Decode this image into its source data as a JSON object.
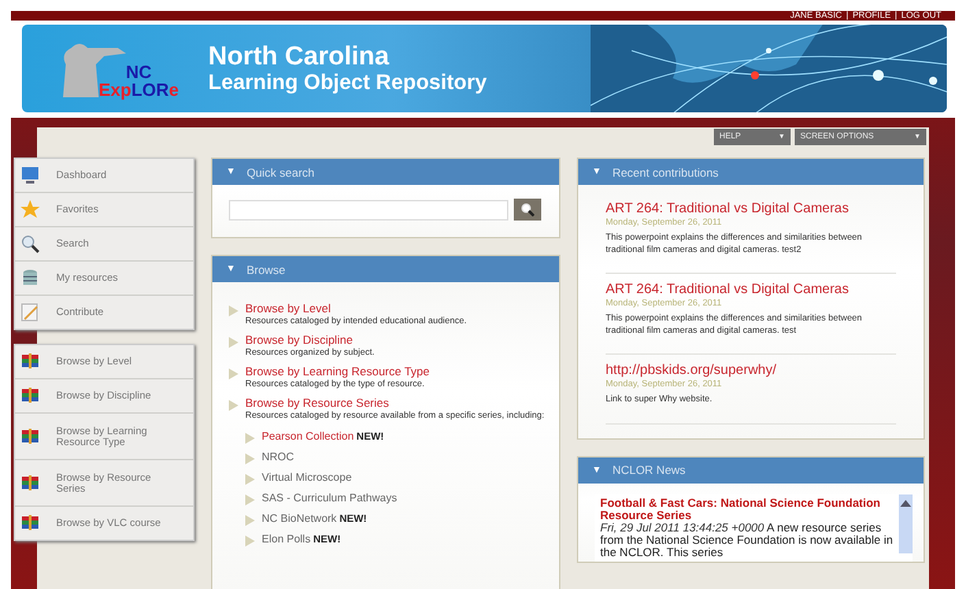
{
  "user_bar": {
    "links": [
      "JANE BASIC",
      "PROFILE",
      "LOG OUT"
    ],
    "separator": "|"
  },
  "banner": {
    "logo": {
      "line1": "NC",
      "line2": [
        {
          "text": "Exp",
          "color": "#e8202a"
        },
        {
          "text": "LOR",
          "color": "#1a1aa8"
        },
        {
          "text": "e",
          "color": "#e8202a"
        }
      ]
    },
    "title": "North Carolina",
    "subtitle": "Learning Object Repository"
  },
  "toolbar": {
    "buttons": [
      {
        "label": "HELP",
        "arrow": "▼"
      },
      {
        "label": "SCREEN OPTIONS",
        "arrow": "▼"
      }
    ]
  },
  "sidebar": {
    "groups": [
      {
        "items": [
          {
            "label": "Dashboard"
          },
          {
            "label": "Favorites"
          },
          {
            "label": "Search"
          },
          {
            "label": "My resources"
          },
          {
            "label": "Contribute"
          }
        ]
      },
      {
        "items": [
          {
            "label": "Browse by Level"
          },
          {
            "label": "Browse by Discipline"
          },
          {
            "label": "Browse by Learning Resource Type"
          },
          {
            "label": "Browse by Resource Series"
          },
          {
            "label": "Browse by VLC course"
          }
        ]
      }
    ]
  },
  "quick_search": {
    "title": "Quick search",
    "toggle": "▼"
  },
  "browse": {
    "title": "Browse",
    "toggle": "▼",
    "items": [
      {
        "title": "Browse by Level",
        "description": "Resources cataloged by intended educational audience."
      },
      {
        "title": "Browse by Discipline",
        "description": "Resources organized by subject."
      },
      {
        "title": "Browse by Learning Resource Type",
        "description": "Resources cataloged by the type of resource."
      },
      {
        "title": "Browse by Resource Series",
        "description": "Resources cataloged by resource available from a specific series, including:",
        "children": [
          {
            "label": "Pearson Collection",
            "linked": true,
            "badge": "NEW!"
          },
          {
            "label": "NROC",
            "linked": false
          },
          {
            "label": "Virtual Microscope",
            "linked": false
          },
          {
            "label": "SAS - Curriculum Pathways",
            "linked": false
          },
          {
            "label": "NC BioNetwork",
            "linked": false,
            "badge": "NEW!"
          },
          {
            "label": "Elon Polls",
            "linked": false,
            "badge": "NEW!"
          }
        ]
      }
    ]
  },
  "recent": {
    "title": "Recent contributions",
    "toggle": "▼",
    "items": [
      {
        "title": "ART 264: Traditional vs Digital Cameras",
        "date": "Monday, September 26, 2011",
        "text": "This powerpoint explains the differences and similarities between traditional film cameras and digital cameras. test2"
      },
      {
        "title": "ART 264: Traditional vs Digital Cameras",
        "date": "Monday, September 26, 2011",
        "text": "This powerpoint explains the differences and similarities between traditional film cameras and digital cameras. test"
      },
      {
        "title": "http://pbskids.org/superwhy/",
        "date": "Monday, September 26, 2011",
        "text": "Link to super Why website."
      }
    ]
  },
  "news": {
    "title": "NCLOR News",
    "toggle": "▼",
    "items": [
      {
        "title": "Football & Fast Cars: National Science Foundation Resource Series",
        "date": "Fri, 29 Jul 2011 13:44:25 +0000",
        "text": "A new resource series from the National Science Foundation is now available in the NCLOR. This series"
      }
    ]
  }
}
